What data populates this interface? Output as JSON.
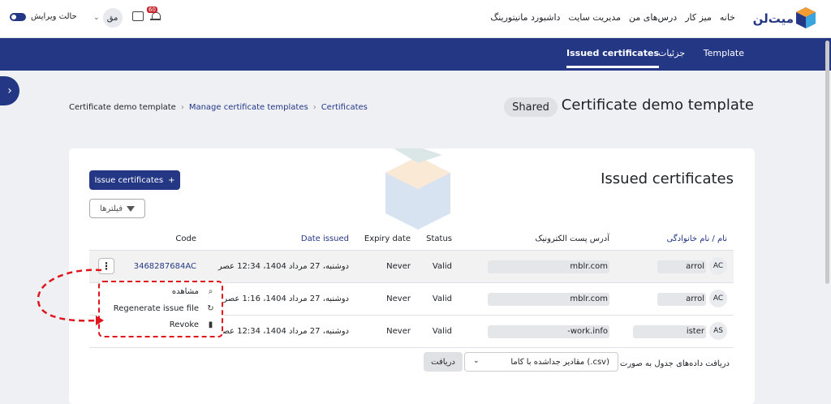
{
  "topbar": {
    "brand": "میت‌لن",
    "nav": [
      "خانه",
      "میز کار",
      "درس‌های من",
      "مدیریت سایت",
      "داشبورد مانیتورینگ"
    ],
    "user_initials": "مق",
    "notification_count": "60",
    "edit_mode_label": "حالت ویرایش"
  },
  "subnav": {
    "items": [
      "Template",
      "جزئیات",
      "Issued certificates"
    ]
  },
  "header": {
    "breadcrumb": [
      "Certificate demo template",
      "Manage certificate templates",
      "Certificates"
    ],
    "title": "Certificate demo template",
    "badge": "Shared"
  },
  "card": {
    "title": "Issued certificates",
    "issue_button": "Issue certificates",
    "filter_button": "فیلترها"
  },
  "table": {
    "headers": {
      "name": "نام / نام خانوادگی",
      "email": "آدرس پست الکترونیک",
      "status": "Status",
      "expiry": "Expiry date",
      "issued": "Date issued",
      "code": "Code"
    },
    "rows": [
      {
        "initials": "AC",
        "name": "arrol",
        "email": "mblr.com",
        "status": "Valid",
        "expiry": "Never",
        "issued": "دوشنبه، 27 مرداد 1404، 12:34 عصر",
        "code": "3468287684AC"
      },
      {
        "initials": "AC",
        "name": "arrol",
        "email": "mblr.com",
        "status": "Valid",
        "expiry": "Never",
        "issued": "دوشنبه، 27 مرداد 1404، 1:16 عصر",
        "code": ""
      },
      {
        "initials": "AS",
        "name": "ister",
        "email": "-work.info",
        "status": "Valid",
        "expiry": "Never",
        "issued": "دوشنبه، 27 مرداد 1404، 12:34 عصر",
        "code": ""
      }
    ]
  },
  "menu": {
    "items": [
      "مشاهده",
      "Regenerate issue file",
      "Revoke"
    ],
    "icons": [
      "search-icon",
      "refresh-icon",
      "trash-icon"
    ]
  },
  "download": {
    "label": "دریافت داده‌های جدول به صورت",
    "selected": "مقادیر جداشده با کاما (.csv)",
    "button": "دریافت"
  },
  "colors": {
    "primary": "#243785",
    "highlight": "#e0141b"
  }
}
